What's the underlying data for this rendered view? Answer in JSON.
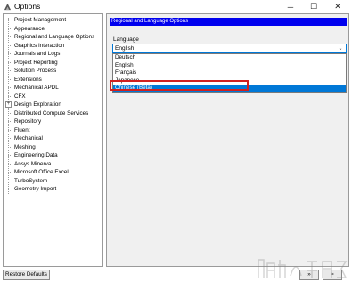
{
  "window": {
    "title": "Options",
    "minimize_glyph": "─",
    "maximize_glyph": "☐",
    "close_glyph": "✕"
  },
  "tree": {
    "items": [
      {
        "label": "Project Management",
        "expandable": false
      },
      {
        "label": "Appearance",
        "expandable": false
      },
      {
        "label": "Regional and Language Options",
        "expandable": false
      },
      {
        "label": "Graphics Interaction",
        "expandable": false
      },
      {
        "label": "Journals and Logs",
        "expandable": false
      },
      {
        "label": "Project Reporting",
        "expandable": false
      },
      {
        "label": "Solution Process",
        "expandable": false
      },
      {
        "label": "Extensions",
        "expandable": false
      },
      {
        "label": "Mechanical APDL",
        "expandable": false
      },
      {
        "label": "CFX",
        "expandable": false
      },
      {
        "label": "Design Exploration",
        "expandable": true
      },
      {
        "label": "Distributed Compute Services",
        "expandable": false
      },
      {
        "label": "Repository",
        "expandable": false
      },
      {
        "label": "Fluent",
        "expandable": false
      },
      {
        "label": "Mechanical",
        "expandable": false
      },
      {
        "label": "Meshing",
        "expandable": false
      },
      {
        "label": "Engineering Data",
        "expandable": false
      },
      {
        "label": "Ansys Minerva",
        "expandable": false
      },
      {
        "label": "Microsoft Office Excel",
        "expandable": false
      },
      {
        "label": "TurboSystem",
        "expandable": false
      },
      {
        "label": "Geometry Import",
        "expandable": false
      }
    ],
    "expander_glyph": "+"
  },
  "panel": {
    "header": "Regional and Language Options",
    "language_label": "Language",
    "language_value": "English",
    "dropdown_arrow": "⌄",
    "options": [
      "Deutsch",
      "English",
      "Français",
      "Japanese",
      "Chinese (Beta)"
    ],
    "selected_index": 4
  },
  "buttons": {
    "restore_defaults": "Restore Defaults",
    "btn1": "»",
    "btn2": "≈"
  },
  "colors": {
    "header_bg": "#0000ee",
    "selection_bg": "#0078d7",
    "highlight": "#d02020"
  }
}
